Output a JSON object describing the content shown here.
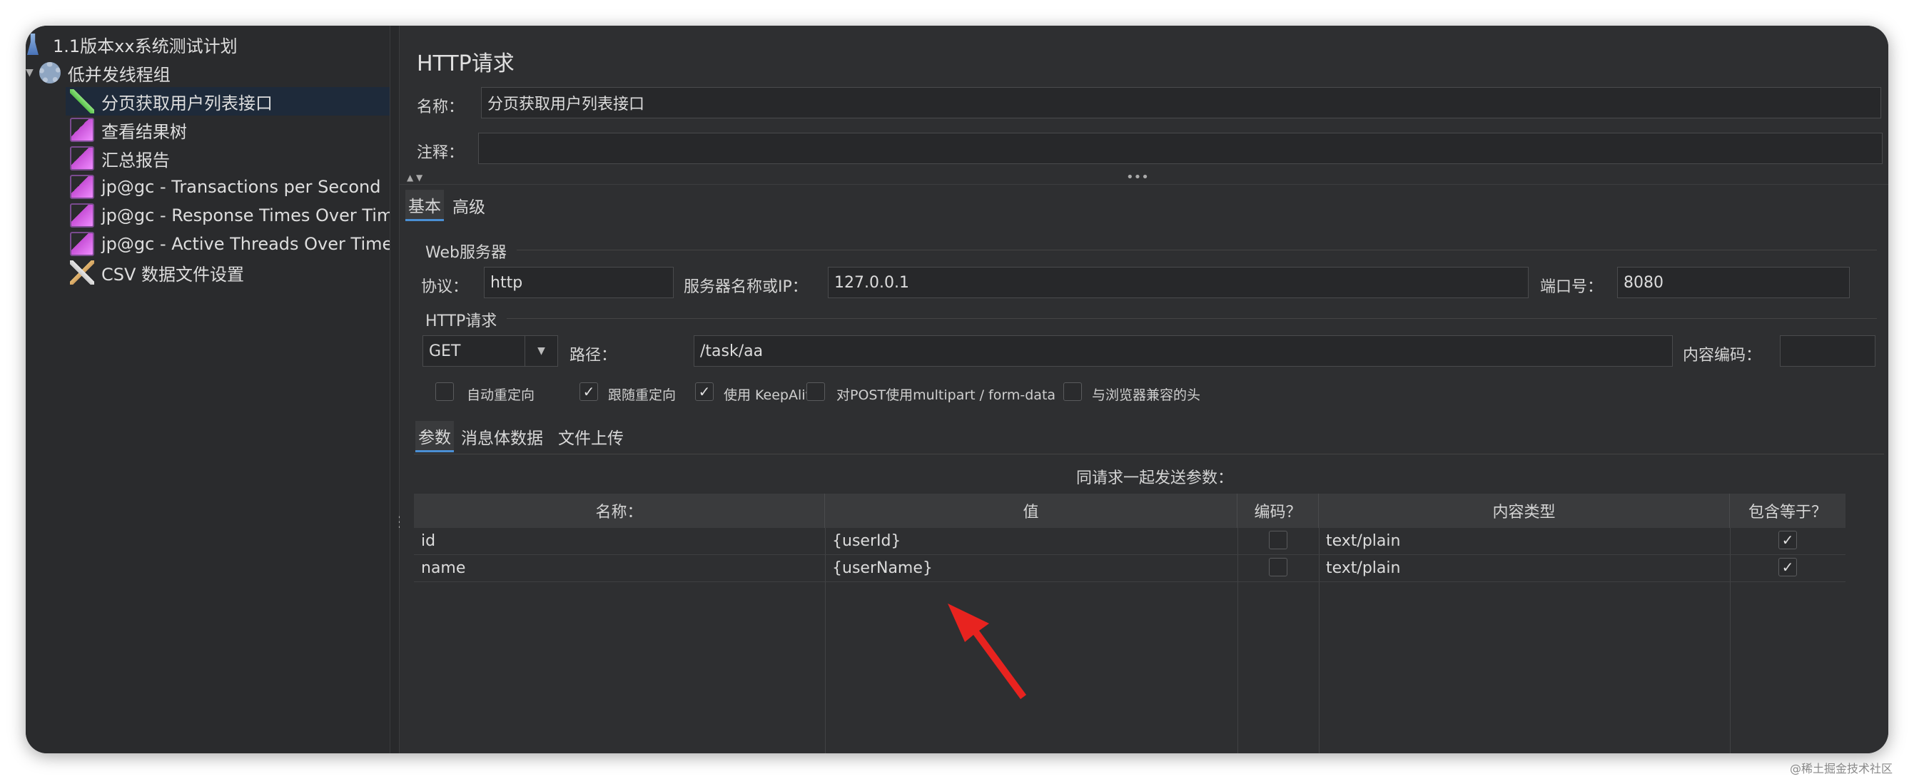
{
  "tree": {
    "items": [
      {
        "label": "1.1版本xx系统测试计划",
        "icon": "flask-icon"
      },
      {
        "label": "低并发线程组",
        "icon": "gear-icon"
      },
      {
        "label": "分页获取用户列表接口",
        "icon": "pen-icon"
      },
      {
        "label": "查看结果树",
        "icon": "graph-icon"
      },
      {
        "label": "汇总报告",
        "icon": "graph-icon"
      },
      {
        "label": "jp@gc - Transactions per Second",
        "icon": "graph-icon"
      },
      {
        "label": "jp@gc - Response Times Over Time",
        "icon": "graph-icon"
      },
      {
        "label": "jp@gc - Active Threads Over Time",
        "icon": "graph-icon"
      },
      {
        "label": "CSV 数据文件设置",
        "icon": "tools-icon"
      }
    ]
  },
  "panel": {
    "title": "HTTP请求",
    "name_label": "名称：",
    "name_value": "分页获取用户列表接口",
    "comment_label": "注释：",
    "comment_value": ""
  },
  "tabs": {
    "basic": "基本",
    "advanced": "高级"
  },
  "web_server": {
    "section": "Web服务器",
    "protocol_label": "协议：",
    "protocol_value": "http",
    "server_label": "服务器名称或IP：",
    "server_value": "127.0.0.1",
    "port_label": "端口号：",
    "port_value": "8080"
  },
  "http_request": {
    "section": "HTTP请求",
    "method": "GET",
    "path_label": "路径：",
    "path_value": "/task/aa",
    "encoding_label": "内容编码：",
    "encoding_value": ""
  },
  "options": [
    {
      "label": "自动重定向",
      "checked": false
    },
    {
      "label": "跟随重定向",
      "checked": true
    },
    {
      "label": "使用 KeepAlive",
      "checked": true
    },
    {
      "label": "对POST使用multipart / form-data",
      "checked": false
    },
    {
      "label": "与浏览器兼容的头",
      "checked": false
    }
  ],
  "subtabs": {
    "params": "参数",
    "body": "消息体数据",
    "files": "文件上传"
  },
  "params_caption": "同请求一起发送参数：",
  "table": {
    "headers": [
      "名称：",
      "值",
      "编码？",
      "内容类型",
      "包含等于？"
    ],
    "rows": [
      {
        "name": "id",
        "value": "{userId}",
        "encode": false,
        "content_type": "text/plain",
        "include_equals": true
      },
      {
        "name": "name",
        "value": "{userName}",
        "encode": false,
        "content_type": "text/plain",
        "include_equals": true
      }
    ]
  },
  "colors": {
    "accent": "#4a8fd4",
    "arrow": "#e8231f",
    "background": "#2e2f31"
  },
  "watermark": "@稀土掘金技术社区"
}
